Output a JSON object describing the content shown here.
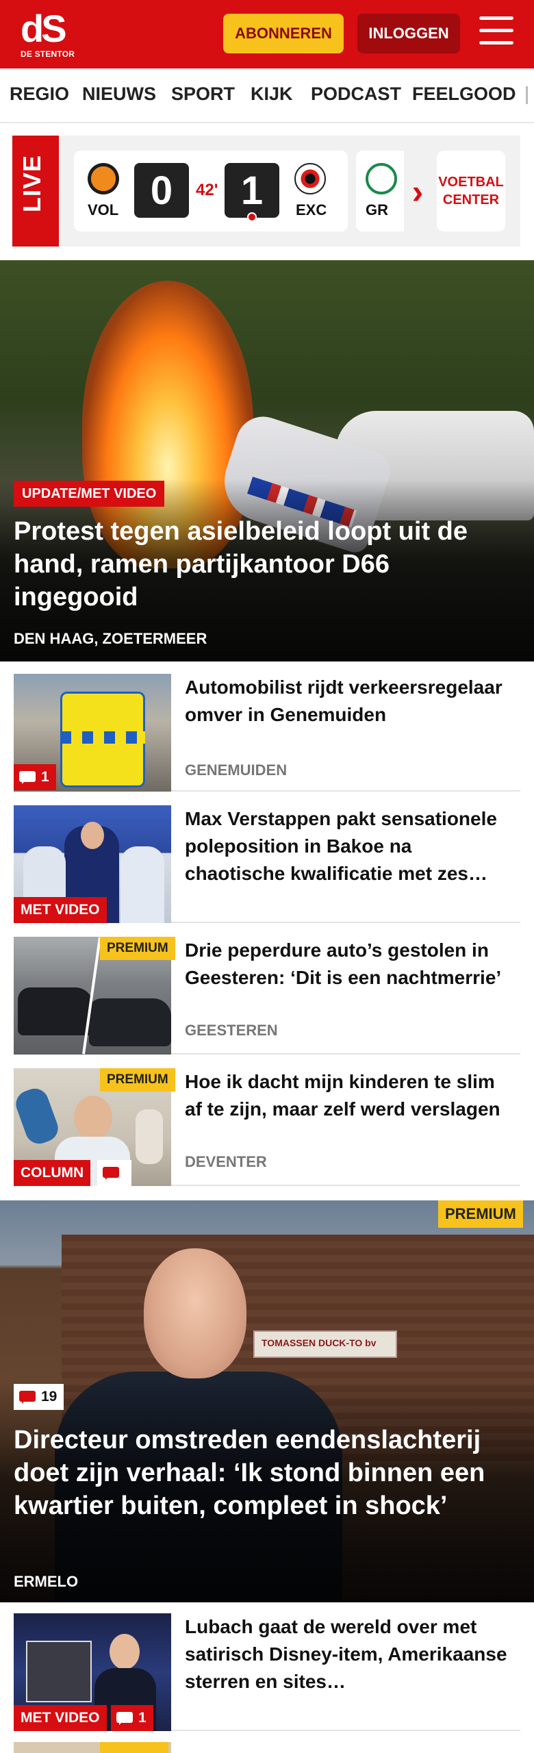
{
  "header": {
    "logo_mark": "dS",
    "logo_sub": "DE STENTOR",
    "subscribe_label": "ABONNEREN",
    "login_label": "INLOGGEN"
  },
  "nav": {
    "items": [
      "REGIO",
      "NIEUWS",
      "SPORT",
      "KIJK",
      "PODCAST",
      "FEELGOOD"
    ]
  },
  "live": {
    "label": "LIVE",
    "match": {
      "home_code": "VOL",
      "home_score": "0",
      "minute": "42'",
      "away_score": "1",
      "away_code": "EXC"
    },
    "next_team_code": "GR",
    "voetbal_center_line1": "VOETBAL",
    "voetbal_center_line2": "CENTER"
  },
  "hero": {
    "badge": "UPDATE/MET VIDEO",
    "title": "Protest tegen asielbeleid loopt uit de hand, ramen partijkantoor D66 ingegooid",
    "place": "DEN HAAG, ZOETERMEER"
  },
  "articles": [
    {
      "title": "Automobilist rijdt verkeersrege­laar omver in Genemuiden",
      "place": "GENEMUIDEN",
      "comments": "1"
    },
    {
      "title": "Max Verstappen pakt sensationele poleposition in Bakoe na chaotische kwalificatie met zes…",
      "badge": "MET VIDEO"
    },
    {
      "title": "Drie peperdure auto’s gestolen in Geesteren: ‘Dit is een nachtmer­rie’",
      "place": "GEESTEREN",
      "premium": "PREMIUM"
    },
    {
      "title": "Hoe ik dacht mijn kinderen te slim af te zijn, maar zelf werd verslagen",
      "place": "DEVENTER",
      "premium": "PREMIUM",
      "badge": "COLUMN"
    }
  ],
  "feature": {
    "premium": "PREMIUM",
    "comments": "19",
    "title": "Directeur omstreden eendenslachte­rij doet zijn verhaal: ‘Ik stond binnen een kwartier buiten, compleet in shock’",
    "place": "ERMELO",
    "sign_text": "TOMASSEN DUCK-TO bv"
  },
  "article_last": {
    "title": "Lubach gaat de wereld over met satirisch Disney-item, Amerikaanse sterren en sites…",
    "badge": "MET VIDEO",
    "comments": "1"
  },
  "colors": {
    "brand_red": "#d60d11",
    "premium_yellow": "#f7c21b"
  }
}
